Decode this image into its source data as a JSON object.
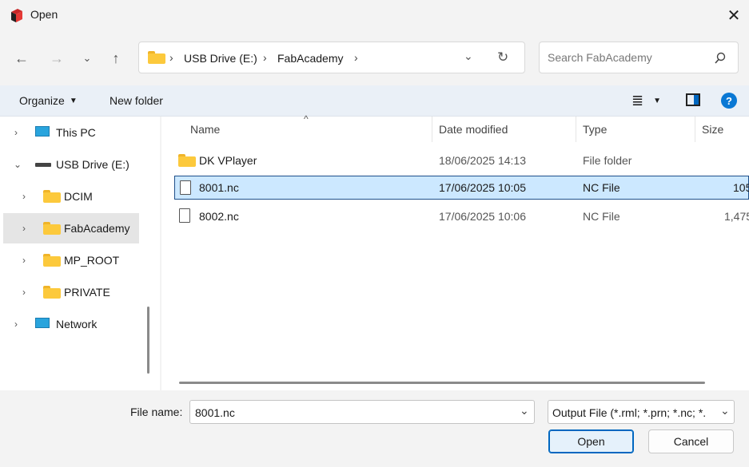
{
  "window": {
    "title": "Open"
  },
  "address": {
    "segments": [
      "USB Drive (E:)",
      "FabAcademy"
    ]
  },
  "search": {
    "placeholder": "Search FabAcademy"
  },
  "toolbar": {
    "organize_label": "Organize",
    "new_folder_label": "New folder"
  },
  "nav_tree": [
    {
      "label": "This PC",
      "icon": "monitor-icon",
      "expanded": false
    },
    {
      "label": "USB Drive (E:)",
      "icon": "usb-drive-icon",
      "expanded": true
    },
    {
      "label": "DCIM",
      "icon": "folder-icon",
      "expanded": false
    },
    {
      "label": "FabAcademy",
      "icon": "folder-icon",
      "expanded": false,
      "selected": true
    },
    {
      "label": "MP_ROOT",
      "icon": "folder-icon",
      "expanded": false
    },
    {
      "label": "PRIVATE",
      "icon": "folder-icon",
      "expanded": false
    },
    {
      "label": "Network",
      "icon": "network-icon",
      "expanded": false
    }
  ],
  "columns": {
    "name": "Name",
    "date": "Date modified",
    "type": "Type",
    "size": "Size"
  },
  "files": [
    {
      "name": "DK VPlayer",
      "date": "18/06/2025 14:13",
      "type": "File folder",
      "size": "",
      "icon": "folder-icon",
      "selected": false
    },
    {
      "name": "8001.nc",
      "date": "17/06/2025 10:05",
      "type": "NC File",
      "size": "105",
      "icon": "file-icon",
      "selected": true
    },
    {
      "name": "8002.nc",
      "date": "17/06/2025 10:06",
      "type": "NC File",
      "size": "1,475",
      "icon": "file-icon",
      "selected": false
    }
  ],
  "footer": {
    "file_name_label": "File name:",
    "file_name_value": "8001.nc",
    "filter_value": "Output File (*.rml; *.prn; *.nc; *.",
    "open_label": "Open",
    "cancel_label": "Cancel"
  },
  "colors": {
    "accent": "#0067c0",
    "selection": "#cce8ff",
    "folder": "#fcc93c"
  }
}
